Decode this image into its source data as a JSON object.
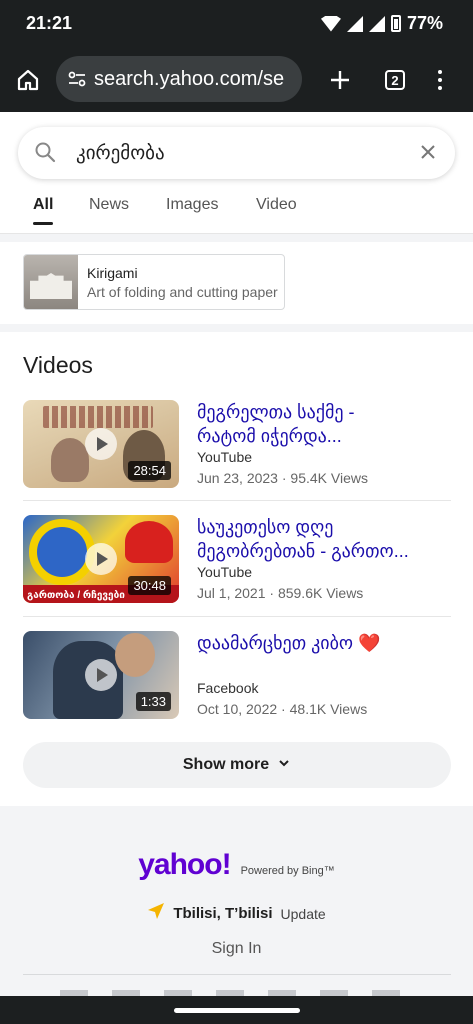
{
  "status_bar": {
    "time": "21:21",
    "battery": "77%"
  },
  "browser": {
    "url": "search.yahoo.com/se",
    "tab_count": "2"
  },
  "search": {
    "query": "კირემობა"
  },
  "tabs": [
    {
      "label": "All",
      "active": true
    },
    {
      "label": "News",
      "active": false
    },
    {
      "label": "Images",
      "active": false
    },
    {
      "label": "Video",
      "active": false
    }
  ],
  "knowledge_card": {
    "title": "Kirigami",
    "description": "Art of folding and cutting paper"
  },
  "videos_section": {
    "title": "Videos",
    "items": [
      {
        "title_line1": "მეგრელთა საქმე -",
        "title_line2": "რატომ იჭერდა...",
        "source": "YouTube",
        "date": "Jun 23, 2023",
        "views": "95.4K Views",
        "duration": "28:54"
      },
      {
        "title_line1": "საუკეთესო დღე",
        "title_line2": "მეგობრებთან - გართო...",
        "source": "YouTube",
        "date": "Jul 1, 2021",
        "views": "859.6K Views",
        "duration": "30:48",
        "thumb_banner": "გართობა / რჩევები"
      },
      {
        "title_line1": "დაამარცხეთ კიბო ❤️",
        "title_line2": "",
        "source": "Facebook",
        "date": "Oct 10, 2022",
        "views": "48.1K Views",
        "duration": "1:33"
      }
    ]
  },
  "show_more": {
    "label": "Show more"
  },
  "footer": {
    "logo": "yahoo!",
    "powered_by": "Powered by Bing™",
    "location": "Tbilisi, T’bilisi",
    "update_label": "Update",
    "sign_in": "Sign In"
  },
  "colors": {
    "link": "#1a0dab",
    "brand": "#6001d2",
    "chrome_dark": "#1c1f20"
  }
}
